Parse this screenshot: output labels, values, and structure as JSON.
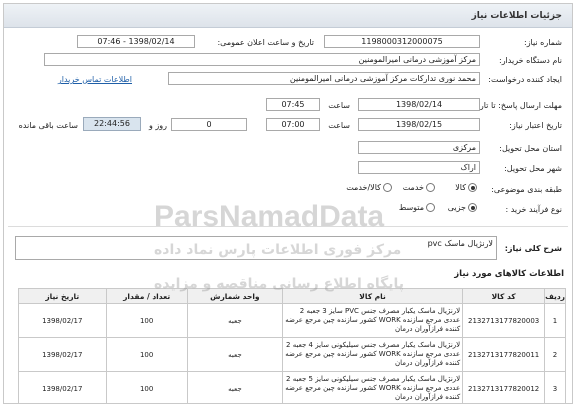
{
  "title": "جزئیات اطلاعات نیاز",
  "fields": {
    "need_number_label": "شماره نیاز:",
    "need_number": "1198000312000075",
    "announce_label": "تاریخ و ساعت اعلان عمومی:",
    "announce_value": "1398/02/14 - 07:46",
    "buyer_label": "نام دستگاه خریدار:",
    "buyer": "مرکز آموزشی درمانی امیرالمومنین",
    "creator_label": "ایجاد کننده درخواست:",
    "creator": "محمد نوری تدارکات مرکز آموزشی درمانی امیرالمومنین",
    "contact_link": "اطلاعات تماس خریدار",
    "send_deadline_label": "مهلت ارسال پاسخ: تا تاریخ:",
    "send_date": "1398/02/14",
    "time_label": "ساعت",
    "send_time": "07:45",
    "validity_label": "تاریخ اعتبار نیاز:",
    "validity_date": "1398/02/15",
    "validity_time": "07:00",
    "days_value": "0",
    "days_label": "روز و",
    "remaining_time": "22:44:56",
    "remaining_label": "ساعت باقی مانده",
    "province_label": "استان محل تحویل:",
    "province": "مرکزی",
    "city_label": "شهر محل تحویل:",
    "city": "اراک",
    "category_label": "طبقه بندی موضوعی:",
    "category_options": [
      "کالا",
      "خدمت",
      "کالا/خدمت"
    ],
    "category_selected": "کالا",
    "process_label": "نوع فرآیند خرید :",
    "process_options": [
      "جزیی",
      "متوسط"
    ],
    "process_selected": "جزیی"
  },
  "description": {
    "label": "شرح کلی نیاز:",
    "value": "لارنژیال ماسک pvc"
  },
  "items_section_title": "اطلاعات کالاهای مورد نیاز",
  "table": {
    "headers": [
      "ردیف",
      "کد کالا",
      "نام کالا",
      "واحد شمارش",
      "تعداد / مقدار",
      "تاریخ نیاز"
    ],
    "rows": [
      [
        "1",
        "2132713177820003",
        "لارنژیال ماسک یکبار مصرف جنس PVC سایز 3 جعبه 2 عددی مرجع سازنده WORK کشور سازنده چین مرجع عرضه کننده فرازآوران درمان",
        "جعبه",
        "100",
        "1398/02/17"
      ],
      [
        "2",
        "2132713177820011",
        "لارنژیال ماسک یکبار مصرف جنس سیلیکونی سایز 4 جعبه 2 عددی مرجع سازنده WORK کشور سازنده چین مرجع عرضه کننده فرازآوران درمان",
        "جعبه",
        "100",
        "1398/02/17"
      ],
      [
        "3",
        "2132713177820012",
        "لارنژیال ماسک یکبار مصرف جنس سیلیکونی سایز 5 جعبه 2 عددی مرجع سازنده WORK کشور سازنده چین مرجع عرضه کننده فرازآوران درمان",
        "جعبه",
        "100",
        "1398/02/17"
      ]
    ]
  },
  "watermark": {
    "line1": "ParsNamadData",
    "line2": "مرکز فوری اطلاعات پارس نماد داده",
    "line3": "پایگاه اطلاع رسانی مناقصه و مزایده"
  }
}
